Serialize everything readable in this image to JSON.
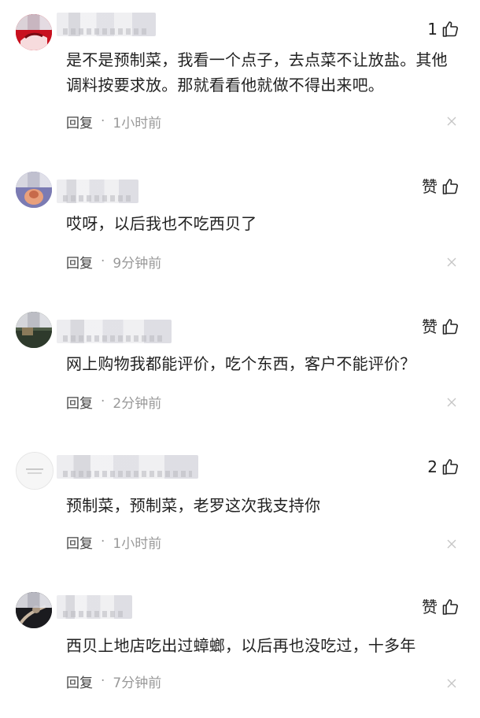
{
  "comments": [
    {
      "likes": "1",
      "text": "是不是预制菜，我看一个点子，去点菜不让放盐。其他调料按要求放。那就看看他就做不得出来吧。",
      "reply_label": "回复",
      "separator": "·",
      "time": "1小时前",
      "avatar_color": "#c8101e"
    },
    {
      "likes": "赞",
      "text": "哎呀，以后我也不吃西贝了",
      "reply_label": "回复",
      "separator": "·",
      "time": "9分钟前",
      "avatar_color": "#6f6fa6"
    },
    {
      "likes": "赞",
      "text": "网上购物我都能评价，吃个东西，客户不能评价？",
      "reply_label": "回复",
      "separator": "·",
      "time": "2分钟前",
      "avatar_color": "#5d6f56"
    },
    {
      "likes": "2",
      "text": "预制菜，预制菜，老罗这次我支持你",
      "reply_label": "回复",
      "separator": "·",
      "time": "1小时前",
      "avatar_color": "#f2f2f2"
    },
    {
      "likes": "赞",
      "text": "西贝上地店吃出过蟑螂，以后再也没吃过，十多年",
      "reply_label": "回复",
      "separator": "·",
      "time": "7分钟前",
      "avatar_color": "#1e1e22"
    }
  ],
  "icons": {
    "like": "thumbs-up-icon",
    "close": "close-icon"
  }
}
